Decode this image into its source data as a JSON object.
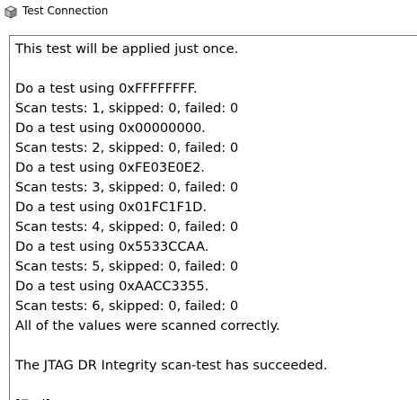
{
  "window": {
    "title": "Test Connection",
    "icon": "cube-app-icon"
  },
  "output": {
    "lines": [
      "This test will be applied just once.",
      "",
      "Do a test using 0xFFFFFFFF.",
      "Scan tests: 1, skipped: 0, failed: 0",
      "Do a test using 0x00000000.",
      "Scan tests: 2, skipped: 0, failed: 0",
      "Do a test using 0xFE03E0E2.",
      "Scan tests: 3, skipped: 0, failed: 0",
      "Do a test using 0x01FC1F1D.",
      "Scan tests: 4, skipped: 0, failed: 0",
      "Do a test using 0x5533CCAA.",
      "Scan tests: 5, skipped: 0, failed: 0",
      "Do a test using 0xAACC3355.",
      "Scan tests: 6, skipped: 0, failed: 0",
      "All of the values were scanned correctly.",
      "",
      "The JTAG DR Integrity scan-test has succeeded.",
      "",
      "[End]"
    ]
  }
}
